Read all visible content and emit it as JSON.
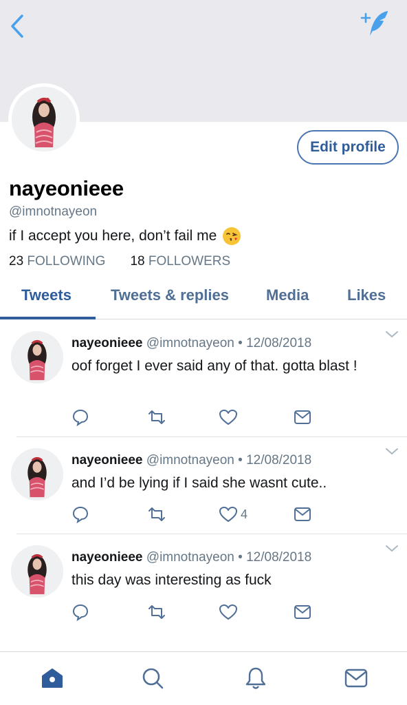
{
  "header": {
    "back_icon": "chevron-left-icon",
    "compose_icon": "compose-tweet-icon",
    "accent_color": "#4aa1eb",
    "background_color": "#e9e9ee"
  },
  "profile": {
    "display_name": "nayeonieee",
    "handle": "@imnotnayeon",
    "bio": "if I accept you here, don’t fail me",
    "bio_emoji": "face-blowing-kiss-emoji",
    "edit_profile_label": "Edit profile",
    "following_count": "23",
    "following_label": "FOLLOWING",
    "followers_count": "18",
    "followers_label": "FOLLOWERS"
  },
  "tabs": [
    {
      "label": "Tweets",
      "active": true
    },
    {
      "label": "Tweets & replies",
      "active": false
    },
    {
      "label": "Media",
      "active": false
    },
    {
      "label": "Likes",
      "active": false
    }
  ],
  "tweets": [
    {
      "name": "nayeonieee",
      "handle": "@imnotnayeon",
      "separator": "•",
      "date": "12/08/2018",
      "text": "oof forget I ever said any of that. gotta blast !",
      "like_count": ""
    },
    {
      "name": "nayeonieee",
      "handle": "@imnotnayeon",
      "separator": "•",
      "date": "12/08/2018",
      "text": "and I’d be lying if I said she wasnt cute..",
      "like_count": "4"
    },
    {
      "name": "nayeonieee",
      "handle": "@imnotnayeon",
      "separator": "•",
      "date": "12/08/2018",
      "text": "this day was interesting as fuck",
      "like_count": ""
    }
  ],
  "tweet_action_icons": [
    "reply-icon",
    "retweet-icon",
    "like-heart-icon",
    "direct-message-icon"
  ],
  "bottom_nav": {
    "items": [
      "home-icon",
      "search-icon",
      "notifications-bell-icon",
      "messages-envelope-icon"
    ],
    "active": "home-icon",
    "active_color": "#2f5c9a",
    "inactive_color": "#4f6f96"
  }
}
